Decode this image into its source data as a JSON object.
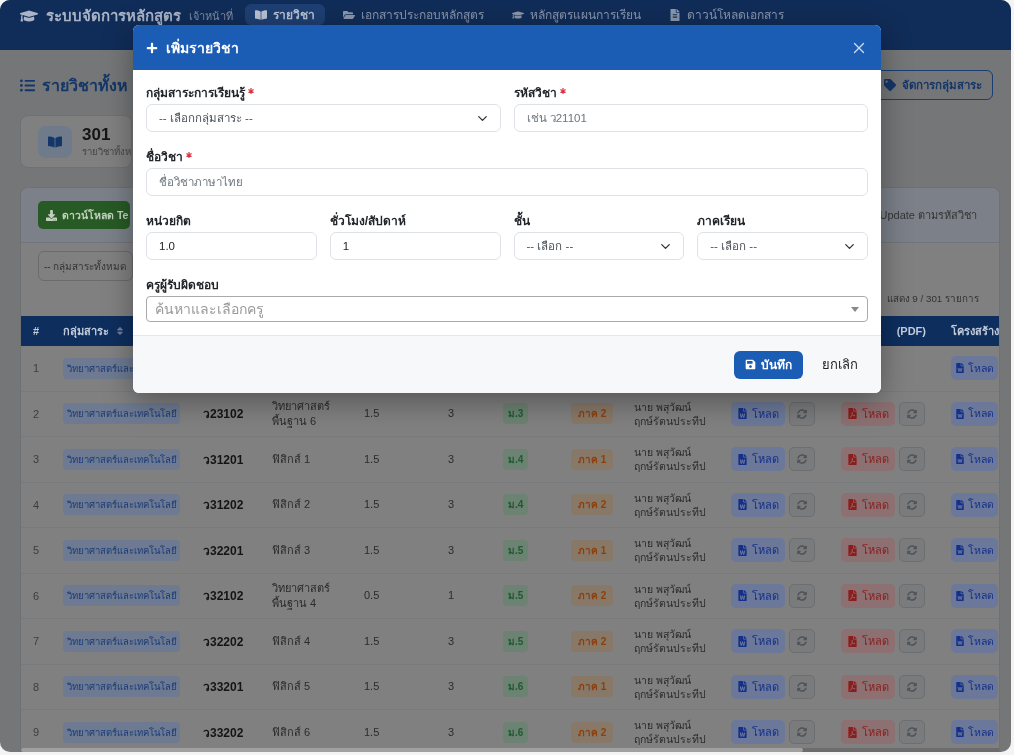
{
  "navbar": {
    "title": "ระบบจัดการหลักสูตร",
    "role": "เจ้าหน้าที่",
    "items": [
      {
        "label": "รายวิชา",
        "selected": true
      },
      {
        "label": "เอกสารประกอบหลักสูตร",
        "selected": false
      },
      {
        "label": "หลักสูตรแผนการเรียน",
        "selected": false
      },
      {
        "label": "ดาวน์โหลดเอกสาร",
        "selected": false
      }
    ]
  },
  "page": {
    "title": "รายวิชาทั้งห",
    "manage_button": "จัดการกลุ่มสาระ"
  },
  "stat": {
    "value": "301",
    "label": "รายวิชาทั้งห"
  },
  "import_panel": {
    "download_button": "ดาวน์โหลด Te",
    "note": "Update ตามรหัสวิชา"
  },
  "filters": {
    "group_select": "-- กลุ่มสาระทั้งหมด",
    "count": "แสดง 9 / 301 รายการ"
  },
  "table": {
    "header": {
      "number": "#",
      "group": "กลุ่มสาระ",
      "pdf": "(PDF)",
      "structure": "โครงสร้าง"
    },
    "rows": [
      {
        "number": "1",
        "group": "วิทยาศาสตร์และ",
        "structure_button": "โหลด"
      },
      {
        "number": "2",
        "group": "วิทยาศาสตร์และเทคโนโลยี",
        "code": "ว23102",
        "name": "วิทยาศาสตร์ พื้นฐาน 6",
        "credits": "1.5",
        "hours": "3",
        "grade": "ม.3",
        "term": "ภาค 2",
        "teacher": "นาย พสุวัฒน์ ฤกษ์รัตนประทีป",
        "word_button": "โหลด",
        "pdf_button": "โหลด",
        "structure_button": "โหลด"
      },
      {
        "number": "3",
        "group": "วิทยาศาสตร์และเทคโนโลยี",
        "code": "ว31201",
        "name": "ฟิสิกส์ 1",
        "credits": "1.5",
        "hours": "3",
        "grade": "ม.4",
        "term": "ภาค 1",
        "teacher": "นาย พสุวัฒน์ ฤกษ์รัตนประทีป",
        "word_button": "โหลด",
        "pdf_button": "โหลด",
        "structure_button": "โหลด"
      },
      {
        "number": "4",
        "group": "วิทยาศาสตร์และเทคโนโลยี",
        "code": "ว31202",
        "name": "ฟิสิกส์ 2",
        "credits": "1.5",
        "hours": "3",
        "grade": "ม.4",
        "term": "ภาค 2",
        "teacher": "นาย พสุวัฒน์ ฤกษ์รัตนประทีป",
        "word_button": "โหลด",
        "pdf_button": "โหลด",
        "structure_button": "โหลด"
      },
      {
        "number": "5",
        "group": "วิทยาศาสตร์และเทคโนโลยี",
        "code": "ว32201",
        "name": "ฟิสิกส์ 3",
        "credits": "1.5",
        "hours": "3",
        "grade": "ม.5",
        "term": "ภาค 1",
        "teacher": "นาย พสุวัฒน์ ฤกษ์รัตนประทีป",
        "word_button": "โหลด",
        "pdf_button": "โหลด",
        "structure_button": "โหลด"
      },
      {
        "number": "6",
        "group": "วิทยาศาสตร์และเทคโนโลยี",
        "code": "ว32102",
        "name": "วิทยาศาสตร์ พื้นฐาน 4",
        "credits": "0.5",
        "hours": "1",
        "grade": "ม.5",
        "term": "ภาค 2",
        "teacher": "นาย พสุวัฒน์ ฤกษ์รัตนประทีป",
        "word_button": "โหลด",
        "pdf_button": "โหลด",
        "structure_button": "โหลด"
      },
      {
        "number": "7",
        "group": "วิทยาศาสตร์และเทคโนโลยี",
        "code": "ว32202",
        "name": "ฟิสิกส์ 4",
        "credits": "1.5",
        "hours": "3",
        "grade": "ม.5",
        "term": "ภาค 2",
        "teacher": "นาย พสุวัฒน์ ฤกษ์รัตนประทีป",
        "word_button": "โหลด",
        "pdf_button": "โหลด",
        "structure_button": "โหลด"
      },
      {
        "number": "8",
        "group": "วิทยาศาสตร์และเทคโนโลยี",
        "code": "ว33201",
        "name": "ฟิสิกส์ 5",
        "credits": "1.5",
        "hours": "3",
        "grade": "ม.6",
        "term": "ภาค 1",
        "teacher": "นาย พสุวัฒน์ ฤกษ์รัตนประทีป",
        "word_button": "โหลด",
        "pdf_button": "โหลด",
        "structure_button": "โหลด"
      },
      {
        "number": "9",
        "group": "วิทยาศาสตร์และเทคโนโลยี",
        "code": "ว33202",
        "name": "ฟิสิกส์ 6",
        "credits": "1.5",
        "hours": "3",
        "grade": "ม.6",
        "term": "ภาค 2",
        "teacher": "นาย พสุวัฒน์ ฤกษ์รัตนประทีป",
        "word_button": "โหลด",
        "pdf_button": "โหลด",
        "structure_button": "โหลด"
      }
    ]
  },
  "modal": {
    "title": "เพิ่มรายวิชา",
    "rows": [
      {
        "fields": [
          {
            "kind": "select",
            "label": "กลุ่มสาระการเรียนรู้",
            "required": true,
            "value": "-- เลือกกลุ่มสาระ --"
          },
          {
            "kind": "text",
            "label": "รหัสวิชา",
            "required": true,
            "placeholder": "เช่น ว21101"
          }
        ]
      },
      {
        "fields": [
          {
            "kind": "text",
            "label": "ชื่อวิชา",
            "required": true,
            "placeholder": "ชื่อวิชาภาษาไทย"
          }
        ]
      },
      {
        "fields": [
          {
            "kind": "text",
            "label": "หน่วยกิต",
            "required": false,
            "value": "1.0"
          },
          {
            "kind": "text",
            "label": "ชั่วโมง/สัปดาห์",
            "required": false,
            "value": "1"
          },
          {
            "kind": "select",
            "label": "ชั้น",
            "required": false,
            "value": "-- เลือก --"
          },
          {
            "kind": "select",
            "label": "ภาคเรียน",
            "required": false,
            "value": "-- เลือก --"
          }
        ]
      },
      {
        "fields": [
          {
            "kind": "search",
            "label": "ครูผู้รับผิดชอบ",
            "required": false,
            "placeholder": "ค้นหาและเลือกครู"
          }
        ]
      }
    ],
    "save_button": "บันทึก",
    "cancel_button": "ยกเลิก"
  }
}
